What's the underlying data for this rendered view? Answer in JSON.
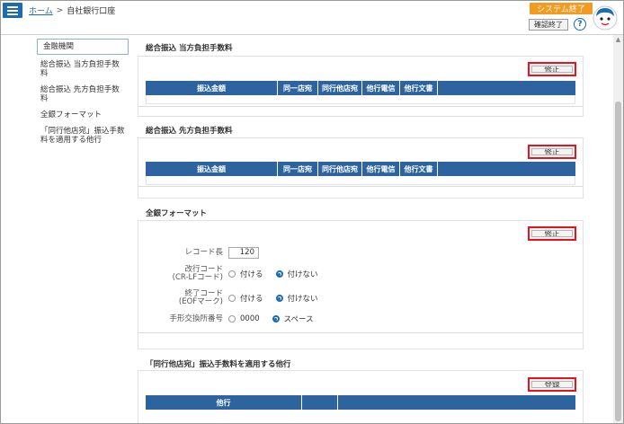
{
  "header": {
    "breadcrumb": {
      "home": "ホーム",
      "separator": ">",
      "current": "自社銀行口座"
    },
    "system_end_label": "システム終了",
    "confirm_end_label": "確認終了",
    "help_label": "?"
  },
  "left_nav": {
    "items": [
      {
        "label": "金融機関"
      },
      {
        "label": "総合振込 当方負担手数料"
      },
      {
        "label": "総合振込 先方負担手数料"
      },
      {
        "label": "全銀フォーマット"
      },
      {
        "label": "「同行他店宛」振込手数料を適用する他行"
      }
    ]
  },
  "sections": {
    "fee_own": {
      "title": "総合振込 当方負担手数料",
      "button": "修正",
      "columns": [
        "振込金額",
        "同一店宛",
        "同行他店宛",
        "他行電信",
        "他行文書"
      ]
    },
    "fee_payee": {
      "title": "総合振込 先方負担手数料",
      "button": "修正",
      "columns": [
        "振込金額",
        "同一店宛",
        "同行他店宛",
        "他行電信",
        "他行文書"
      ]
    },
    "zengin": {
      "title": "全銀フォーマット",
      "button": "修正",
      "record_length": {
        "label": "レコード長",
        "value": "120"
      },
      "line_feed": {
        "label_1": "改行コード",
        "label_2": "(CR-LFコード)",
        "options": [
          "付ける",
          "付けない"
        ],
        "selected": "付けない"
      },
      "end_code": {
        "label_1": "終了コード",
        "label_2": "(EOFマーク)",
        "options": [
          "付ける",
          "付けない"
        ],
        "selected": "付けない"
      },
      "clearing_house": {
        "label": "手形交換所番号",
        "options": [
          "0000",
          "スペース"
        ],
        "selected": "スペース"
      }
    },
    "other_banks": {
      "title": "「同行他店宛」振込手数料を適用する他行",
      "button": "登録",
      "columns": [
        "他行",
        ""
      ]
    }
  },
  "colors": {
    "accent": "#1b6bb5",
    "table_header": "#2d64a0",
    "system_end": "#f39a1f",
    "highlight_border": "#e5141d"
  }
}
